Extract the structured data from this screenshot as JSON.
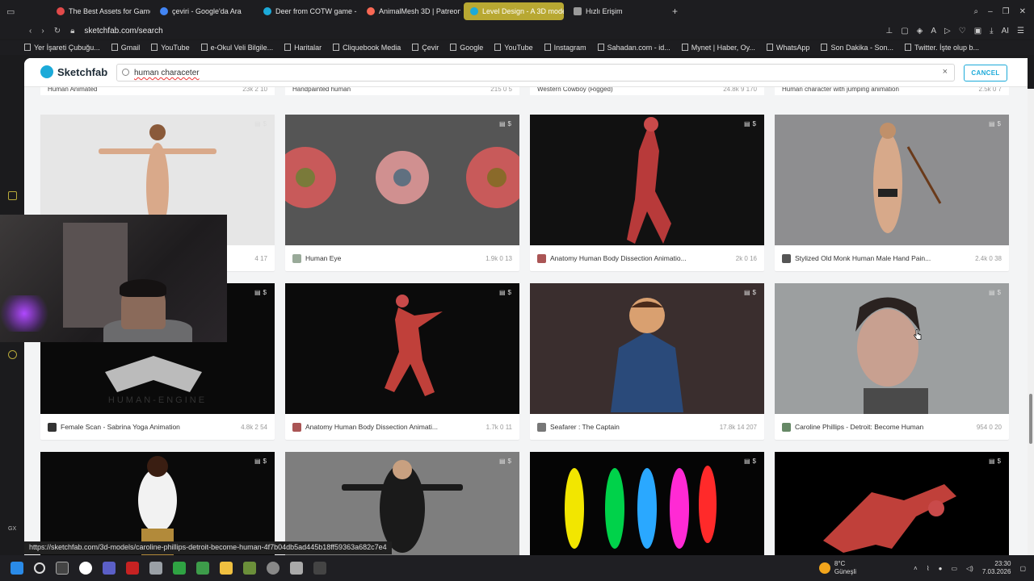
{
  "browser": {
    "tabs": [
      {
        "label": "The Best Assets for Game",
        "color": "#e24a4a"
      },
      {
        "label": "çeviri - Google'da Ara",
        "color": "#4285f4"
      },
      {
        "label": "Deer from COTW game - [",
        "color": "#1caad9"
      },
      {
        "label": "AnimalMesh 3D | Patreon",
        "color": "#f96854"
      },
      {
        "label": "Level Design - A 3D mode",
        "color": "#1caad9"
      },
      {
        "label": "Hızlı Erişim",
        "color": "#9a9a9a"
      }
    ],
    "active_tab_index": 4,
    "url": "sketchfab.com/search",
    "bookmarks": [
      "Yer İşareti Çubuğu...",
      "Gmail",
      "YouTube",
      "e-Okul Veli Bilgile...",
      "Haritalar",
      "Cliquebook Media",
      "Çevir",
      "Google",
      "YouTube",
      "Instagram",
      "Sahadan.com - id...",
      "Mynet | Haber, Oy...",
      "WhatsApp",
      "Son Dakika - Son...",
      "Twitter. İşte olup b..."
    ],
    "status_url": "https://sketchfab.com/3d-models/caroline-phillips-detroit-become-human-4f7b04db5ad445b18ff59363a682c7e4"
  },
  "sketchfab": {
    "logo_text": "Sketchfab",
    "search_value": "human characeter",
    "cancel_label": "CANCEL",
    "top_partial_titles": [
      "Human Animated",
      "Handpainted human",
      "Western Cowboy (Rigged)",
      "Human character with jumping animation"
    ],
    "top_partial_stats": [
      "23k  2  10",
      "215  0  5",
      "24.8k  9  170",
      "2.5k  0  7"
    ],
    "cards": [
      {
        "title": "",
        "stats": "4   17",
        "thumb": "#e6e6e6",
        "avatar": "#888"
      },
      {
        "title": "Human Eye",
        "stats": "1.9k  0  13",
        "thumb": "#555",
        "avatar": "#9a9"
      },
      {
        "title": "Anatomy Human Body Dissection Animatio...",
        "stats": "2k  0  16",
        "thumb": "#111",
        "avatar": "#a55"
      },
      {
        "title": "Stylized Old Monk Human Male Hand Pain...",
        "stats": "2.4k  0  38",
        "thumb": "#8e8e90",
        "avatar": "#555"
      },
      {
        "title": "Female Scan - Sabrina Yoga Animation",
        "stats": "4.8k  2  54",
        "thumb": "#0a0a0a",
        "avatar": "#333"
      },
      {
        "title": "Anatomy Human Body Dissection Animati...",
        "stats": "1.7k  0  11",
        "thumb": "#0b0b0b",
        "avatar": "#a55"
      },
      {
        "title": "Seafarer : The Captain",
        "stats": "17.8k  14  207",
        "thumb": "#3a2e2e",
        "avatar": "#777"
      },
      {
        "title": "Caroline Phillips - Detroit: Become Human",
        "stats": "954  0  20",
        "thumb": "#9c9fa0",
        "avatar": "#686"
      },
      {
        "title": "",
        "stats": "",
        "thumb": "#0a0a0a",
        "avatar": "#333"
      },
      {
        "title": "",
        "stats": "",
        "thumb": "#7e7e7e",
        "avatar": "#333"
      },
      {
        "title": "",
        "stats": "",
        "thumb": "#050505",
        "avatar": "#333"
      },
      {
        "title": "",
        "stats": "",
        "thumb": "#000000",
        "avatar": "#333"
      }
    ],
    "human_engine_text": "HUMAN-ENGINE"
  },
  "taskbar": {
    "temperature": "8°C",
    "weather": "Güneşli",
    "time": "23:30",
    "date": "7.03.2026"
  },
  "side_labels": {
    "gx": "GX"
  }
}
